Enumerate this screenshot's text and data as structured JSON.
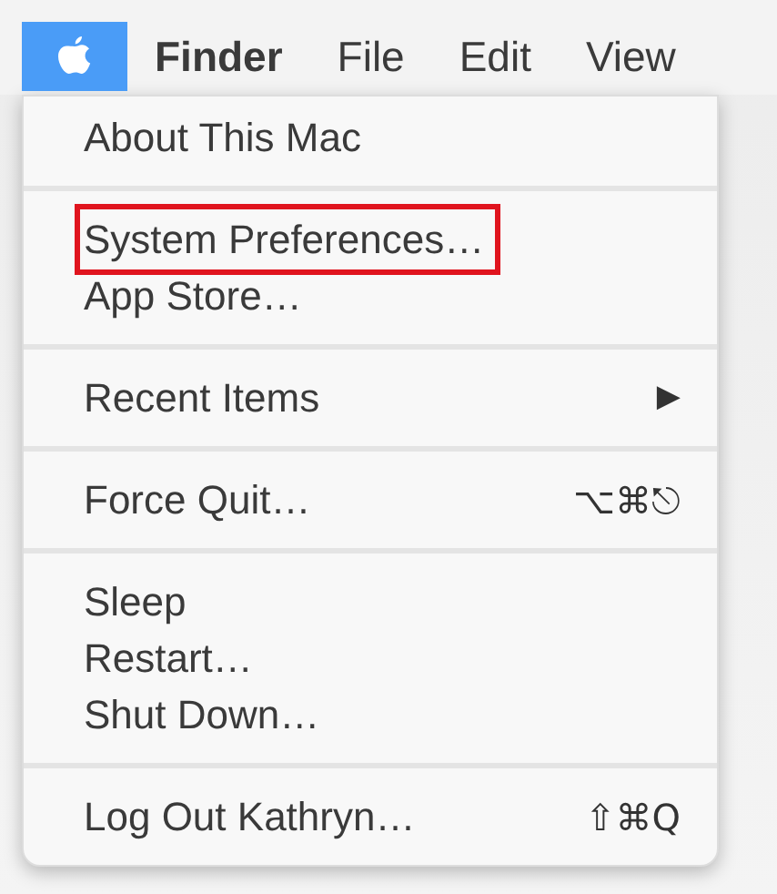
{
  "menu_bar": {
    "items": [
      {
        "kind": "apple",
        "selected": true
      },
      {
        "kind": "app",
        "label": "Finder",
        "selected": false
      },
      {
        "kind": "menu",
        "label": "File",
        "selected": false
      },
      {
        "kind": "menu",
        "label": "Edit",
        "selected": false
      },
      {
        "kind": "menu",
        "label": "View",
        "selected": false
      }
    ]
  },
  "apple_menu": {
    "groups": [
      [
        {
          "label": "About This Mac",
          "annotated": false
        }
      ],
      [
        {
          "label": "System Preferences…",
          "annotated": true
        },
        {
          "label": "App Store…",
          "annotated": false
        }
      ],
      [
        {
          "label": "Recent Items",
          "submenu_arrow": "▶",
          "annotated": false
        }
      ],
      [
        {
          "label": "Force Quit…",
          "shortcut": "⌥⌘⎋",
          "annotated": false
        }
      ],
      [
        {
          "label": "Sleep",
          "annotated": false
        },
        {
          "label": "Restart…",
          "annotated": false
        },
        {
          "label": "Shut Down…",
          "annotated": false
        }
      ],
      [
        {
          "label": "Log Out Kathryn…",
          "shortcut": "⇧⌘Q",
          "annotated": false
        }
      ]
    ]
  }
}
